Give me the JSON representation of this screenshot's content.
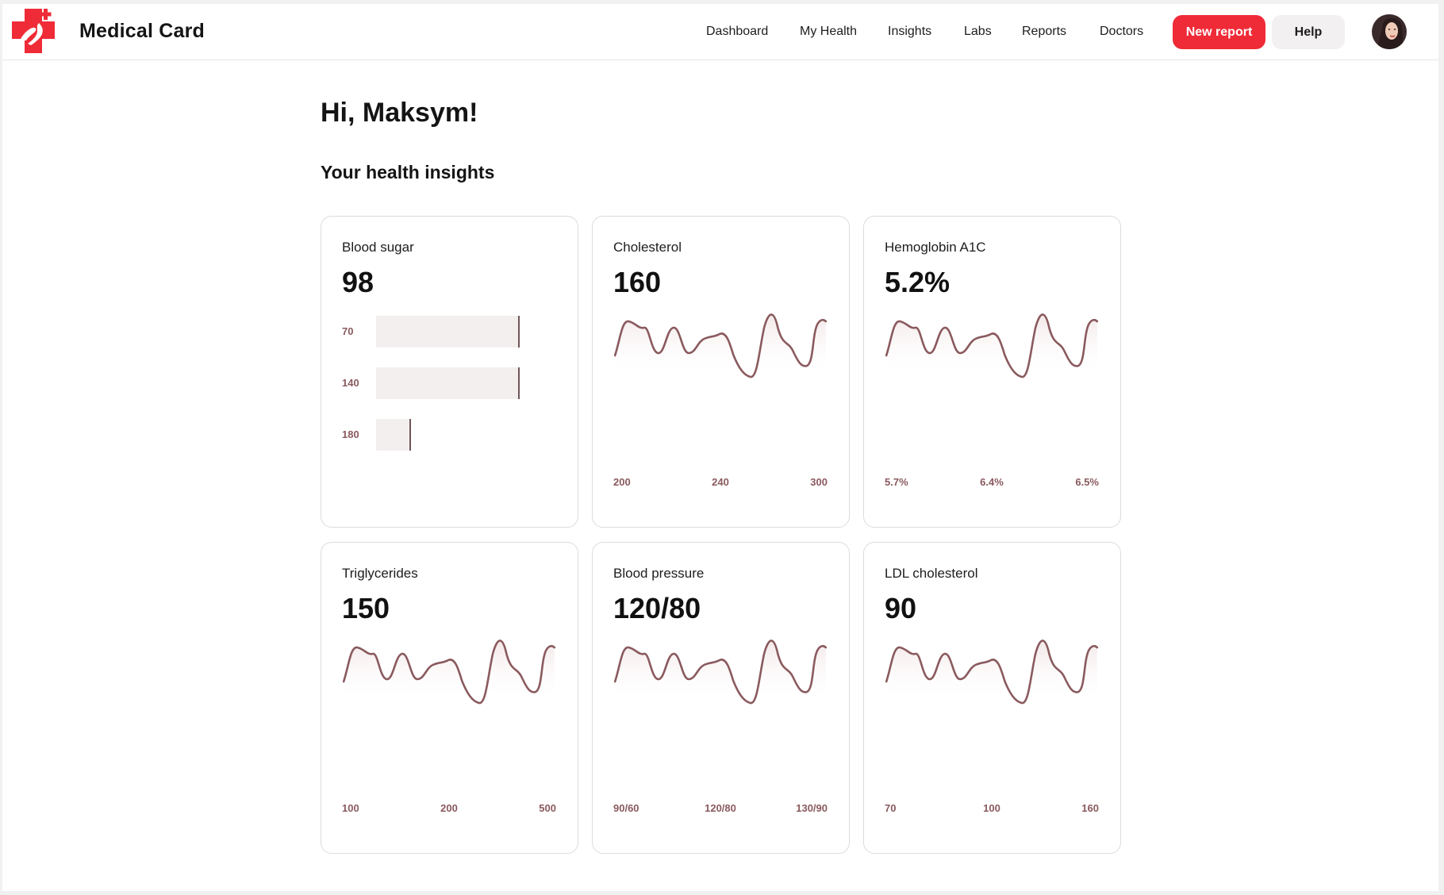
{
  "app": {
    "title": "Medical Card",
    "brand_color": "#ef2b37"
  },
  "nav": {
    "items": [
      "Dashboard",
      "My Health",
      "Insights",
      "Labs",
      "Reports",
      "Doctors"
    ]
  },
  "actions": {
    "new_report": "New report",
    "help": "Help"
  },
  "page": {
    "greeting": "Hi, Maksym!",
    "subheading": "Your health insights"
  },
  "cards": [
    {
      "title": "Blood sugar",
      "value": "98",
      "kind": "bar"
    },
    {
      "title": "Cholesterol",
      "value": "160",
      "kind": "line",
      "axis": [
        "200",
        "240",
        "300"
      ]
    },
    {
      "title": "Hemoglobin A1C",
      "value": "5.2%",
      "kind": "line",
      "axis": [
        "5.7%",
        "6.4%",
        "6.5%"
      ]
    },
    {
      "title": "Triglycerides",
      "value": "150",
      "kind": "line",
      "axis": [
        "100",
        "200",
        "500"
      ]
    },
    {
      "title": "Blood pressure",
      "value": "120/80",
      "kind": "line",
      "axis": [
        "90/60",
        "120/80",
        "130/90"
      ]
    },
    {
      "title": "LDL cholesterol",
      "value": "90",
      "kind": "line",
      "axis": [
        "70",
        "100",
        "160"
      ]
    }
  ],
  "chart_data": {
    "type": "bar",
    "orientation": "horizontal",
    "categories": [
      "70",
      "140",
      "180"
    ],
    "values": [
      1.0,
      1.0,
      0.24
    ],
    "color": "#f3efef",
    "marker_color": "#6e5558"
  },
  "colors": {
    "sparkline_stroke": "#8a5a5e",
    "axis_text": "#8a5a5e"
  }
}
